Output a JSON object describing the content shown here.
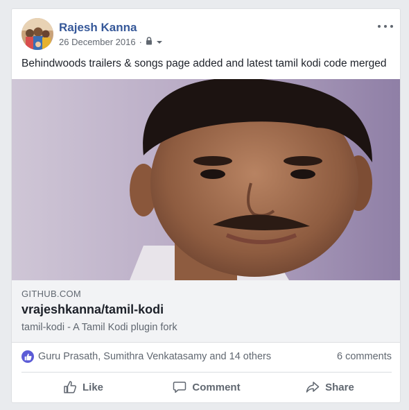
{
  "post": {
    "author": "Rajesh Kanna",
    "date": "26 December 2016",
    "separator": "·",
    "text": "Behindwoods trailers & songs page added and latest tamil kodi code merged"
  },
  "link": {
    "domain": "GITHUB.COM",
    "title": "vrajeshkanna/tamil-kodi",
    "description": "tamil-kodi - A Tamil Kodi plugin fork"
  },
  "reactions": {
    "names": "Guru Prasath, Sumithra Venkatasamy and 14 others",
    "comments": "6 comments"
  },
  "actions": {
    "like": "Like",
    "comment": "Comment",
    "share": "Share"
  },
  "icons": {
    "privacy": "lock-icon",
    "audience": "caret-down-icon",
    "more": "more-options-icon",
    "like_badge": "thumbs-up-icon",
    "like": "thumbs-up-outline-icon",
    "comment": "speech-bubble-icon",
    "share": "share-arrow-icon"
  },
  "colors": {
    "author": "#365899",
    "like_badge": "#5b5bd6",
    "link_bg": "#f2f3f5"
  }
}
